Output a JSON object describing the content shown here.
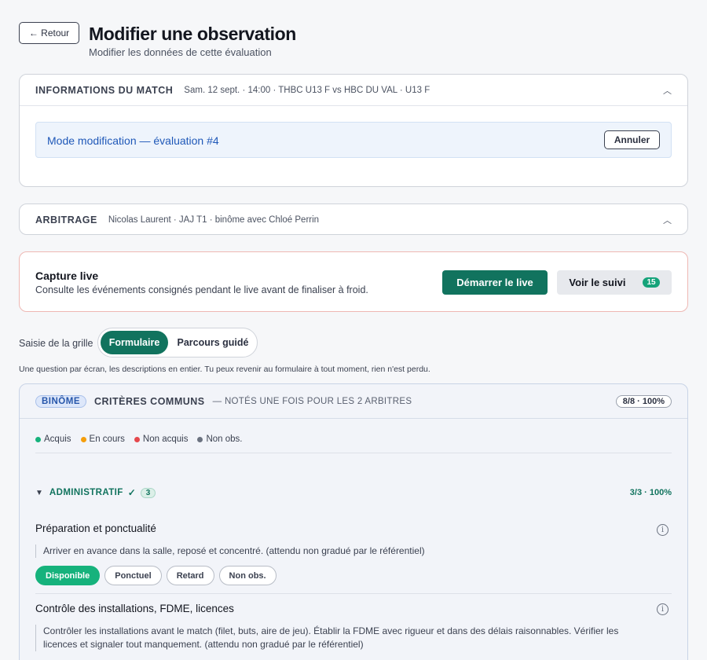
{
  "header": {
    "back_label": "← Retour",
    "title": "Modifier une observation",
    "subtitle": "Modifier les données de cette évaluation"
  },
  "match": {
    "label": "INFORMATIONS DU MATCH",
    "meta": "Sam. 12 sept. · 14:00 · THBC U13 F vs HBC DU VAL · U13 F",
    "mode_text": "Mode modification — évaluation #4",
    "cancel_label": "Annuler"
  },
  "arbitrage": {
    "label": "ARBITRAGE",
    "meta": "Nicolas Laurent · JAJ T1 · binôme avec Chloé Perrin"
  },
  "live": {
    "title": "Capture live",
    "description": "Consulte les événements consignés pendant le live avant de finaliser à froid.",
    "start_label": "Démarrer le live",
    "follow_label": "Voir le suivi",
    "follow_count": "15"
  },
  "grid": {
    "label": "Saisie de la grille",
    "options": [
      "Formulaire",
      "Parcours guidé"
    ],
    "selected": "Formulaire",
    "hint": "Une question par écran, les descriptions en entier. Tu peux revenir au formulaire à tout moment, rien n'est perdu."
  },
  "criteria": {
    "badge": "BINÔME",
    "title": "CRITÈRES COMMUNS",
    "subtitle": "— NOTÉS UNE FOIS POUR LES 2 ARBITRES",
    "score": "8/8 · 100%",
    "legend": [
      {
        "label": "Acquis",
        "color": "#16b27c"
      },
      {
        "label": "En cours",
        "color": "#f59e0b"
      },
      {
        "label": "Non acquis",
        "color": "#e5484d"
      },
      {
        "label": "Non obs.",
        "color": "#6b7280"
      }
    ],
    "section": {
      "name": "ADMINISTRATIF",
      "check": "✓",
      "count": "3",
      "progress": "3/3 · 100%"
    },
    "questions": [
      {
        "title": "Préparation et ponctualité",
        "description": "Arriver en avance dans la salle, reposé et concentré. (attendu non gradué par le référentiel)",
        "options": [
          "Disponible",
          "Ponctuel",
          "Retard",
          "Non obs."
        ],
        "selected": "Disponible"
      },
      {
        "title": "Contrôle des installations, FDME, licences",
        "description": "Contrôler les installations avant le match (filet, buts, aire de jeu). Établir la FDME avec rigueur et dans des délais raisonnables. Vérifier les licences et signaler tout manquement. (attendu non gradué par le référentiel)"
      }
    ]
  },
  "colors": {
    "primary_green": "#11735e",
    "accent_blue": "#1f58b8",
    "live_border": "#eeb8b4"
  }
}
